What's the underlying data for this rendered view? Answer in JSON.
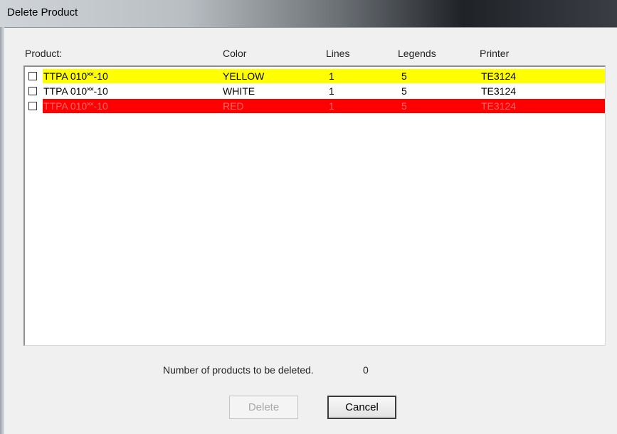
{
  "window": {
    "title": "Delete Product"
  },
  "columns": {
    "product": "Product:",
    "color": "Color",
    "lines": "Lines",
    "legends": "Legends",
    "printer": "Printer"
  },
  "rows": [
    {
      "checked": false,
      "product": "TTPA 010˟˟-10",
      "color": "YELLOW",
      "lines": "1",
      "legends": "5",
      "printer": "TE3124",
      "bg": "#ffff00",
      "fg": "#000000"
    },
    {
      "checked": false,
      "product": "TTPA 010˟˟-10",
      "color": "WHITE",
      "lines": "1",
      "legends": "5",
      "printer": "TE3124",
      "bg": "#ffffff",
      "fg": "#000000"
    },
    {
      "checked": false,
      "product": "TTPA 010˟˟-10",
      "color": "RED",
      "lines": "1",
      "legends": "5",
      "printer": "TE3124",
      "bg": "#ff0000",
      "fg": "#ff6a6a"
    }
  ],
  "footer": {
    "count_label": "Number of products to be deleted.",
    "count_value": "0"
  },
  "buttons": {
    "delete_label": "Delete",
    "cancel_label": "Cancel"
  }
}
